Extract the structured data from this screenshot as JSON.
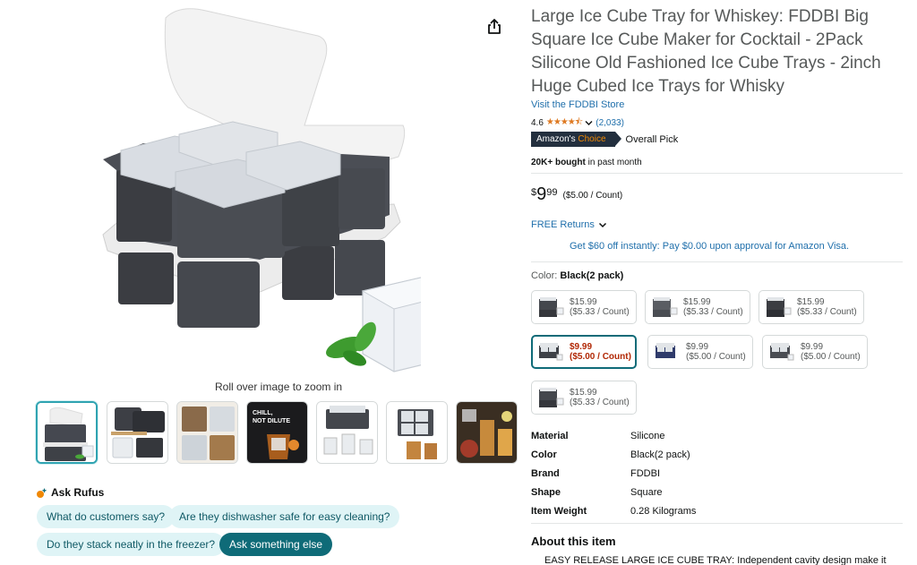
{
  "gallery": {
    "zoom_hint": "Roll over image to zoom in",
    "thumb_texts": [
      "CHILL, NOT DILUTE"
    ]
  },
  "rufus": {
    "title": "Ask Rufus",
    "chips": [
      "What do customers say?",
      "Are they dishwasher safe for easy cleaning?",
      "Do they stack neatly in the freezer?",
      "Ask something else"
    ]
  },
  "product": {
    "title": "Large Ice Cube Tray for Whiskey: FDDBI Big Square Ice Cube Maker for Cocktail - 2Pack Silicone Old Fashioned Ice Cube Trays - 2inch Huge Cubed Ice Trays for Whisky",
    "store_link": "Visit the FDDBI Store",
    "rating": "4.6",
    "rating_count": "(2,033)",
    "rating_stars": 4.6,
    "badge_prefix": "Amazon's",
    "badge_choice": "Choice",
    "badge_label": "Overall Pick",
    "bought_bold": "20K+ bought",
    "bought_rest": "in past month",
    "price_symbol": "$",
    "price_whole": "9",
    "price_fraction": "99",
    "price_unit": "($5.00 / Count)",
    "returns": "FREE Returns",
    "promo": "Get $60 off instantly: Pay $0.00 upon approval for Amazon Visa.",
    "color_label": "Color:",
    "color_value": "Black(2 pack)"
  },
  "swatches": [
    {
      "price": "$15.99",
      "unit": "($5.33 / Count)"
    },
    {
      "price": "$15.99",
      "unit": "($5.33 / Count)"
    },
    {
      "price": "$15.99",
      "unit": "($5.33 / Count)"
    },
    {
      "price": "$9.99",
      "unit": "($5.00 / Count)",
      "selected": true
    },
    {
      "price": "$9.99",
      "unit": "($5.00 / Count)"
    },
    {
      "price": "$9.99",
      "unit": "($5.00 / Count)"
    },
    {
      "price": "$15.99",
      "unit": "($5.33 / Count)"
    }
  ],
  "specs": [
    {
      "key": "Material",
      "value": "Silicone"
    },
    {
      "key": "Color",
      "value": "Black(2 pack)"
    },
    {
      "key": "Brand",
      "value": "FDDBI"
    },
    {
      "key": "Shape",
      "value": "Square"
    },
    {
      "key": "Item Weight",
      "value": "0.28 Kilograms"
    }
  ],
  "about": {
    "heading": "About this item",
    "bullet_1": "EASY RELEASE LARGE ICE CUBE TRAY: Independent cavity design make it"
  },
  "colors": {
    "link": "#1f6fab",
    "title": "#565959",
    "accent_teal": "#0f6b78",
    "chip_bg": "#dff4f6",
    "star": "#de7921",
    "sale_price": "#b12704",
    "badge_bg": "#232f3e",
    "badge_choice": "#f08804"
  }
}
